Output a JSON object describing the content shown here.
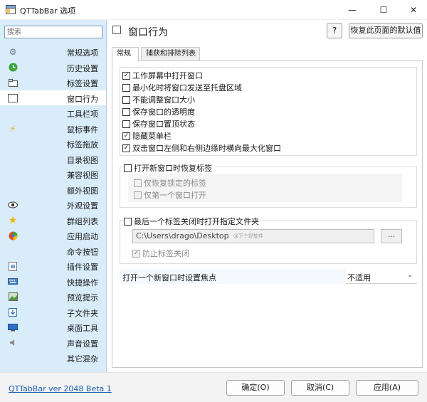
{
  "window": {
    "title": "QTTabBar 选项",
    "icons": {
      "app": "qttabbar-app-icon",
      "minimize": "minimize-icon",
      "maximize": "maximize-icon",
      "close": "close-icon"
    }
  },
  "sidebar": {
    "search_placeholder": "搜索",
    "items": [
      {
        "label": "常规选项",
        "icon": "gear-icon"
      },
      {
        "label": "历史设置",
        "icon": "history-icon"
      },
      {
        "label": "标签设置",
        "icon": "tabs-icon"
      },
      {
        "label": "窗口行为",
        "icon": "window-icon"
      },
      {
        "label": "工具栏项",
        "icon": ""
      },
      {
        "label": "鼠标事件",
        "icon": "lightning-icon"
      },
      {
        "label": "标签拖放",
        "icon": ""
      },
      {
        "label": "目录视图",
        "icon": ""
      },
      {
        "label": "兼容视图",
        "icon": ""
      },
      {
        "label": "额外视图",
        "icon": ""
      },
      {
        "label": "外观设置",
        "icon": "eye-icon"
      },
      {
        "label": "群组列表",
        "icon": "star-icon"
      },
      {
        "label": "应用启动",
        "icon": "app-launch-icon"
      },
      {
        "label": "命令按钮",
        "icon": ""
      },
      {
        "label": "插件设置",
        "icon": "plugin-icon"
      },
      {
        "label": "快捷操作",
        "icon": "keyboard-icon"
      },
      {
        "label": "预览提示",
        "icon": "preview-icon"
      },
      {
        "label": "子文件夹",
        "icon": "subfolder-icon"
      },
      {
        "label": "桌面工具",
        "icon": "desktop-icon"
      },
      {
        "label": "声音设置",
        "icon": "speaker-icon"
      },
      {
        "label": "其它混杂",
        "icon": ""
      }
    ],
    "active_index": 3
  },
  "main": {
    "page_title": "窗口行为",
    "help_label": "?",
    "reset_label": "恢复此页面的默认值",
    "tabs": [
      {
        "label": "常规"
      },
      {
        "label": "捕获和排除列表"
      }
    ],
    "active_tab": 0,
    "options": [
      {
        "label": "工作屏幕中打开窗口",
        "checked": true
      },
      {
        "label": "最小化时将窗口发送至托盘区域",
        "checked": false
      },
      {
        "label": "不能调整窗口大小",
        "checked": false
      },
      {
        "label": "保存窗口的透明度",
        "checked": false
      },
      {
        "label": "保存窗口置顶状态",
        "checked": false
      },
      {
        "label": "隐藏菜单栏",
        "checked": true
      },
      {
        "label": "双击窗口左侧和右侧边缘时横向最大化窗口",
        "checked": true
      }
    ],
    "restore_group": {
      "label": "打开新窗口时恢复标签",
      "checked": false,
      "sub_options": [
        {
          "label": "仅恢复锁定的标签",
          "checked": false
        },
        {
          "label": "仅第一个窗口打开",
          "checked": false
        }
      ]
    },
    "last_tab_group": {
      "label": "最后一个标签关闭时打开指定文件夹",
      "checked": false,
      "path_value": "C:\\Users\\drago\\Desktop",
      "path_watermark": "@下个好软件",
      "browse_label": "...",
      "prevent_label": "防止标签关闭",
      "prevent_checked": true
    },
    "focus": {
      "label": "打开一个新窗口时设置焦点",
      "value": "不适用"
    }
  },
  "footer": {
    "version": "QTTabBar ver 2048 Beta 1",
    "ok": "确定(O)",
    "cancel": "取消(C)",
    "apply": "应用(A)"
  }
}
